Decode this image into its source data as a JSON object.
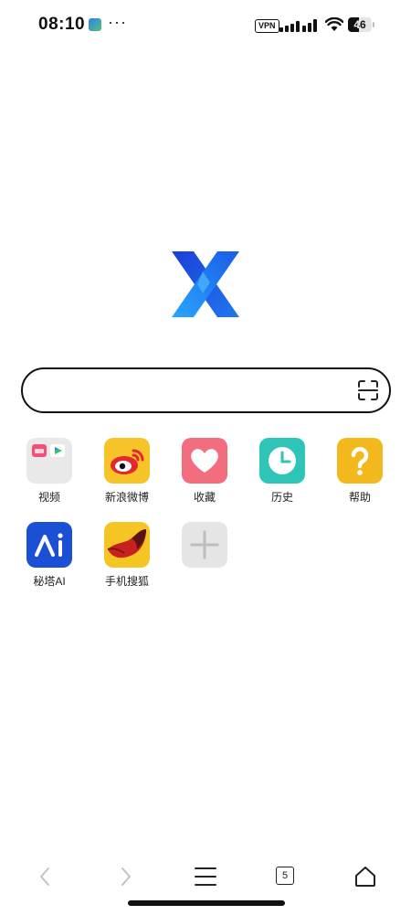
{
  "status_bar": {
    "time": "08:10",
    "more": "···",
    "vpn": "VPN",
    "battery_level": 46,
    "battery_text": "46"
  },
  "logo": {
    "icon": "xbrowser-logo",
    "colors": [
      "#1e4fe0",
      "#27a9ff"
    ]
  },
  "search": {
    "value": "",
    "placeholder": "",
    "scan_icon": "scan-icon"
  },
  "quick_links": [
    {
      "label": "视频",
      "icon": "video-folder-icon",
      "color": "#e9e9ea"
    },
    {
      "label": "新浪微博",
      "icon": "weibo-icon",
      "color": "#f6c329"
    },
    {
      "label": "收藏",
      "icon": "heart-icon",
      "color": "#f26d7d"
    },
    {
      "label": "历史",
      "icon": "clock-icon",
      "color": "#2ec4b6"
    },
    {
      "label": "帮助",
      "icon": "question-icon",
      "color": "#f2b81c"
    },
    {
      "label": "秘塔AI",
      "icon": "metaso-ai-icon",
      "color": "#1a4fd6"
    },
    {
      "label": "手机搜狐",
      "icon": "sohu-fox-icon",
      "color": "#f5c623"
    },
    {
      "label": "",
      "icon": "add-icon",
      "color": "#e5e5e5"
    }
  ],
  "bottom_nav": {
    "back": "back-icon",
    "forward": "forward-icon",
    "menu": "menu-icon",
    "tabs_count": "5",
    "home": "home-icon"
  }
}
